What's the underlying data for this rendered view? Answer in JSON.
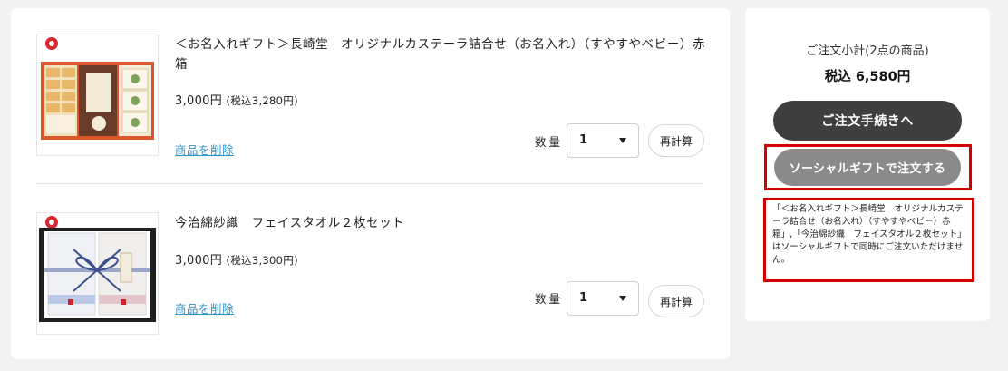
{
  "cart": {
    "items": [
      {
        "name": "＜お名入れギフト＞長崎堂　オリジナルカステーラ詰合せ（お名入れ）（すやすやベビー）赤箱",
        "price": "3,000円",
        "tax_price": "(税込3,280円)",
        "delete_label": "商品を削除",
        "qty_label": "数量",
        "qty_value": "1",
        "recalc_label": "再計算",
        "image_icon": "castella-gift-box-image"
      },
      {
        "name": "今治綿紗織　フェイスタオル２枚セット",
        "price": "3,000円",
        "tax_price": "(税込3,300円)",
        "delete_label": "商品を削除",
        "qty_label": "数量",
        "qty_value": "1",
        "recalc_label": "再計算",
        "image_icon": "towel-gift-set-image"
      }
    ]
  },
  "summary": {
    "subtotal_label": "ご注文小計(2点の商品)",
    "subtotal_value": "税込 6,580円",
    "checkout_label": "ご注文手続きへ",
    "social_gift_label": "ソーシャルギフトで注文する",
    "notice": "「＜お名入れギフト＞長崎堂　オリジナルカステーラ詰合せ（お名入れ）（すやすやベビー）赤箱」,「今治綿紗織　フェイスタオル２枚セット」はソーシャルギフトで同時にご注文いただけません。",
    "highlight_color": "#d40000",
    "checkout_color": "#3f3f3f",
    "social_button_color": "#8a8a8a",
    "link_color": "#2a93c9"
  }
}
